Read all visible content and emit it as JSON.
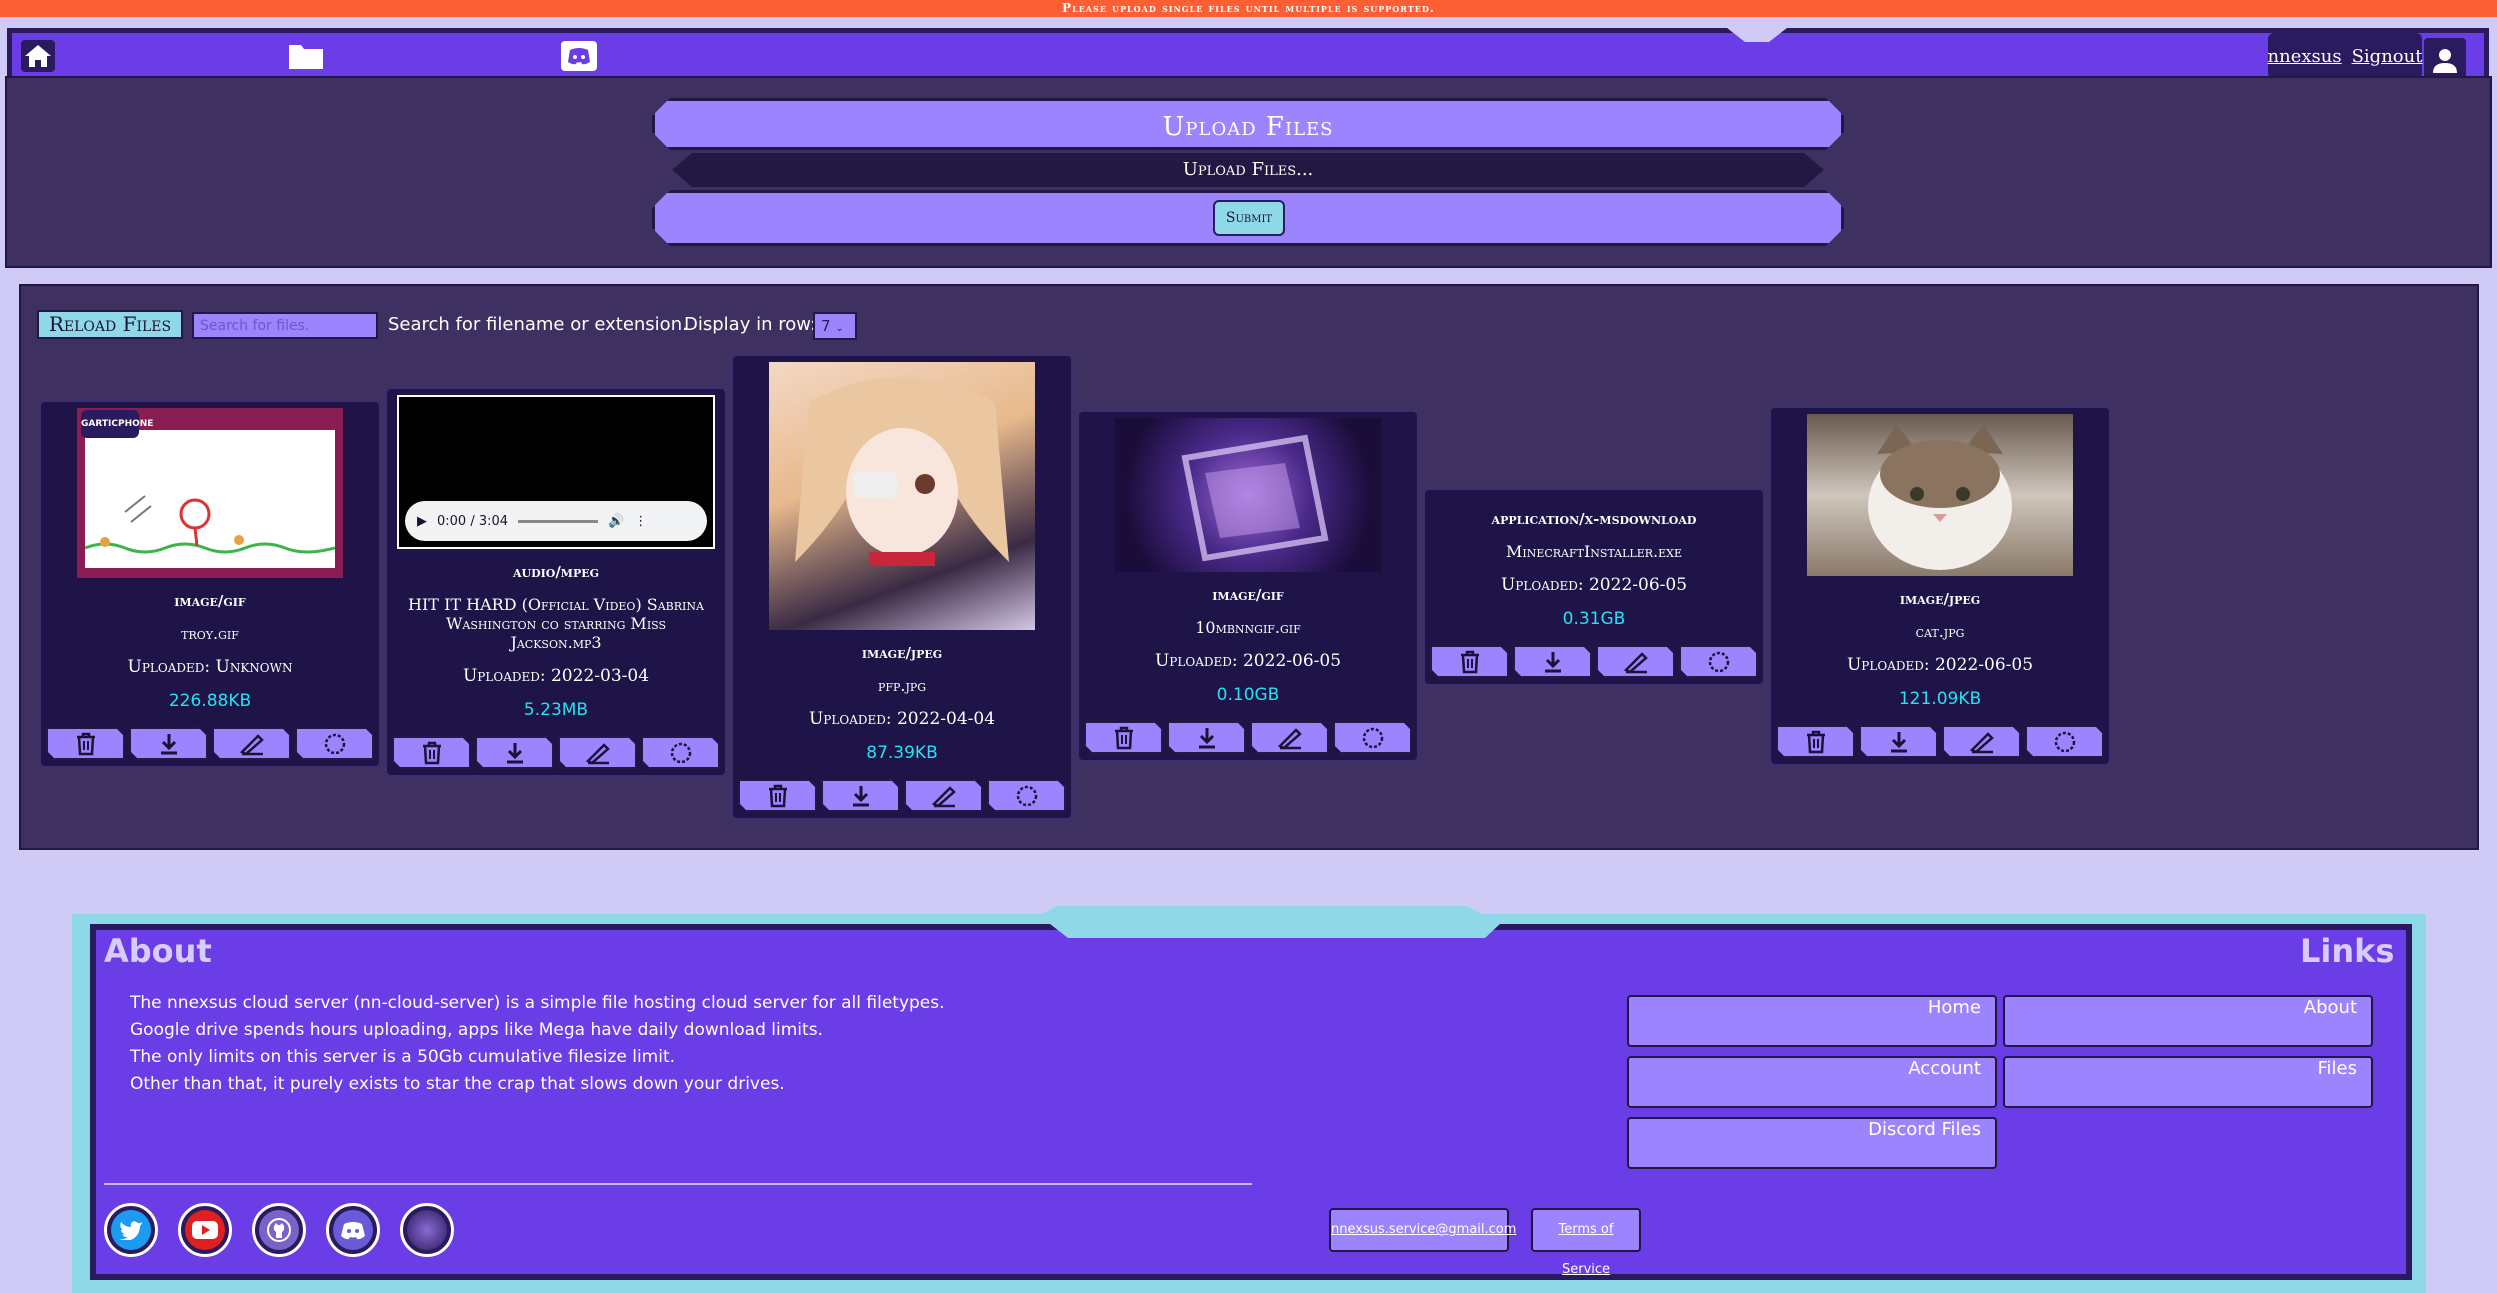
{
  "banner": {
    "text": "Please upload single files until multiple is supported."
  },
  "nav": {
    "icons": [
      "home-icon",
      "folder-icon",
      "discord-icon"
    ],
    "username": "nnexsus",
    "signout": "Signout"
  },
  "upload": {
    "title": "Upload Files",
    "input_label": "Upload Files...",
    "submit": "Submit"
  },
  "files": {
    "reload": "Reload Files",
    "search_placeholder": "Search for files.",
    "search_hint": "Search for filename or extension.",
    "row_label": "Display in row:",
    "row_value": "7",
    "cards": [
      {
        "type": "image/gif",
        "name": "troy.gif",
        "date": "Uploaded: Unknown",
        "size": "226.88KB"
      },
      {
        "type": "audio/mpeg",
        "name": "HIT IT HARD (Official Video) Sabrina Washington co starring Miss Jackson.mp3",
        "date": "Uploaded: 2022-03-04",
        "size": "5.23MB",
        "audio_time": "0:00 / 3:04"
      },
      {
        "type": "image/jpeg",
        "name": "pfp.jpg",
        "date": "Uploaded: 2022-04-04",
        "size": "87.39KB"
      },
      {
        "type": "image/gif",
        "name": "10mbnngif.gif",
        "date": "Uploaded: 2022-06-05",
        "size": "0.10GB"
      },
      {
        "type": "application/x-msdownload",
        "name": "MinecraftInstaller.exe",
        "date": "Uploaded: 2022-06-05",
        "size": "0.31GB"
      },
      {
        "type": "image/jpeg",
        "name": "cat.jpg",
        "date": "Uploaded: 2022-06-05",
        "size": "121.09KB"
      }
    ],
    "card_actions": [
      "trash-icon",
      "download-icon",
      "rename-icon",
      "preview-icon"
    ],
    "thumb_text": "GARTICPHONE"
  },
  "footer": {
    "about_title": "About",
    "links_title": "Links",
    "about_lines": [
      "The nnexsus cloud server (nn-cloud-server) is a simple file hosting cloud server for all filetypes.",
      "Google drive spends hours uploading, apps like Mega have daily download limits.",
      "The only limits on this server is a 50Gb cumulative filesize limit.",
      "Other than that, it purely exists to star the crap that slows down your drives."
    ],
    "links": [
      "Home",
      "About",
      "Account",
      "Files",
      "Discord Files"
    ],
    "email": "nnexsus.service@gmail.com",
    "tos": "Terms of Service",
    "socials": [
      "twitter-icon",
      "youtube-icon",
      "github-icon",
      "discord-icon",
      "profile-icon"
    ]
  },
  "colors": {
    "banner": "#fb5f33",
    "nav": "#6a3de6",
    "panel": "#3e3162",
    "card": "#1f1448",
    "button": "#9c84ff",
    "accent": "#8fd8e8",
    "size_text": "#27e0f0"
  }
}
